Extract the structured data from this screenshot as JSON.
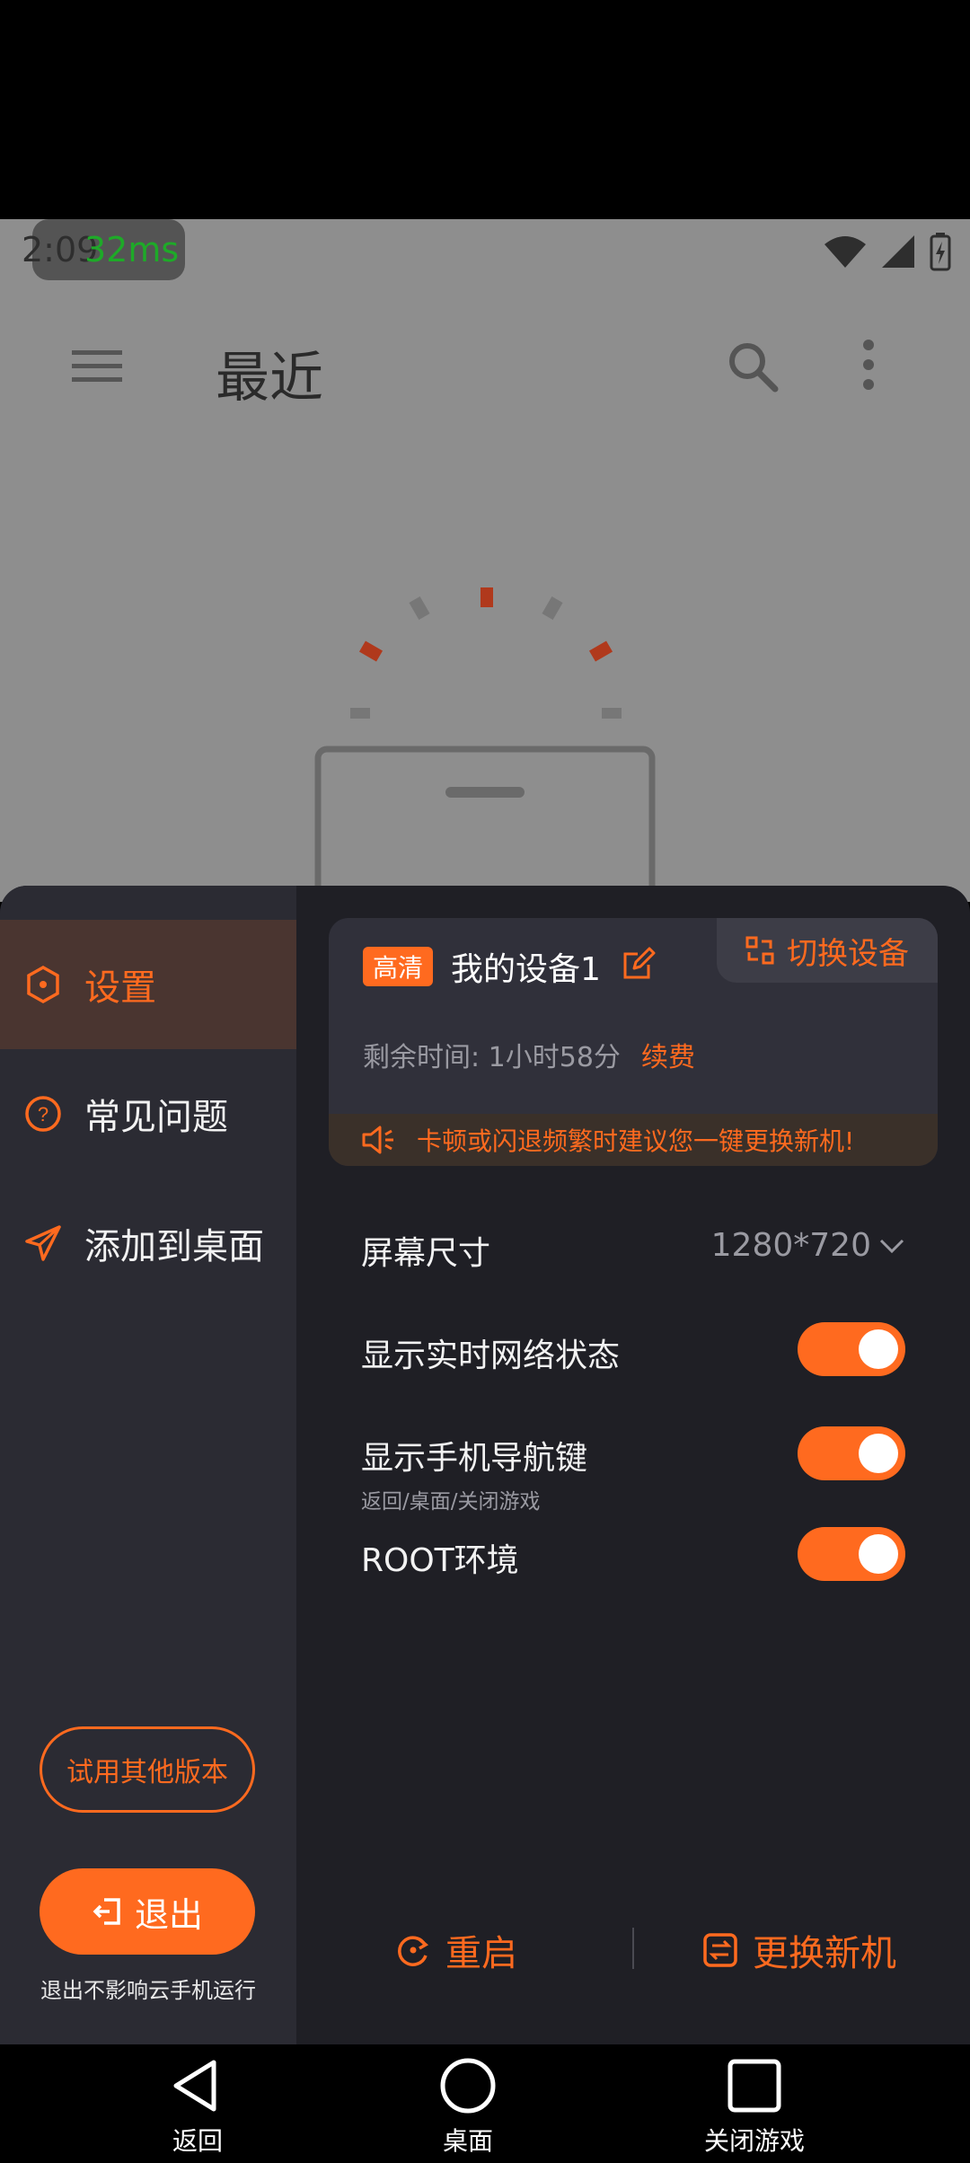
{
  "status_bar": {
    "time": "2:09",
    "latency": "32ms"
  },
  "background_app": {
    "title": "最近",
    "icons": [
      "menu-icon",
      "search-icon",
      "more-vert-icon"
    ]
  },
  "sidebar": {
    "items": [
      {
        "label": "设置",
        "icon": "hexagon-settings-icon",
        "active": true
      },
      {
        "label": "常见问题",
        "icon": "help-circle-icon",
        "active": false
      },
      {
        "label": "添加到桌面",
        "icon": "send-icon",
        "active": false
      }
    ],
    "try_other_version": "试用其他版本",
    "logout": "退出",
    "logout_note": "退出不影响云手机运行"
  },
  "device": {
    "badge": "高清",
    "name": "我的设备1",
    "switch_label": "切换设备",
    "remaining": "剩余时间: 1小时58分",
    "renew": "续费",
    "notice": "卡顿或闪退频繁时建议您一键更换新机!"
  },
  "settings": {
    "screen_size_label": "屏幕尺寸",
    "screen_size_value": "1280*720",
    "network_status_label": "显示实时网络状态",
    "network_status_on": true,
    "nav_keys_label": "显示手机导航键",
    "nav_keys_sub": "返回/桌面/关闭游戏",
    "nav_keys_on": true,
    "root_label": "ROOT环境",
    "root_on": true
  },
  "actions": {
    "restart": "重启",
    "replace": "更换新机"
  },
  "navbar": {
    "back": "返回",
    "home": "桌面",
    "close": "关闭游戏"
  },
  "colors": {
    "accent": "#ff6a1f",
    "sheet_bg": "#1f1f25",
    "sidebar_bg": "#2b2b33"
  }
}
